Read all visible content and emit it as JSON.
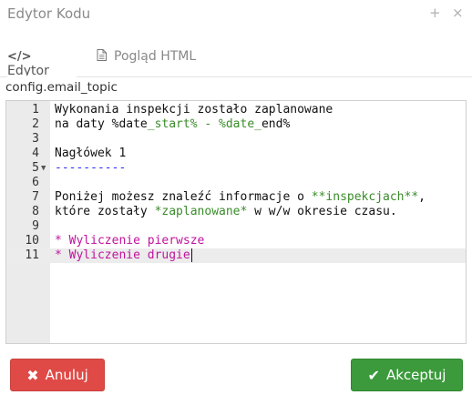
{
  "window": {
    "title": "Edytor Kodu",
    "plus_glyph": "+",
    "close_glyph": "×"
  },
  "tabs": [
    {
      "label": "Edytor",
      "icon": "code-icon",
      "active": true
    },
    {
      "label": "Pogląd HTML",
      "icon": "file-icon",
      "active": false
    }
  ],
  "config_label": "config.email_topic",
  "editor": {
    "line_numbers": [
      "1",
      "2",
      "3",
      "4",
      "5",
      "6",
      "7",
      "8",
      "9",
      "10",
      "11"
    ],
    "fold_marker_line": 5,
    "active_line": 11,
    "lines": [
      {
        "parts": [
          {
            "t": "Wykonania inspekcji zostało zaplanowane",
            "c": "plain"
          }
        ]
      },
      {
        "parts": [
          {
            "t": "na daty %date",
            "c": "plain"
          },
          {
            "t": "_start% - %date_",
            "c": "hl"
          },
          {
            "t": "end%",
            "c": "plain"
          }
        ]
      },
      {
        "parts": []
      },
      {
        "parts": [
          {
            "t": "Nagłówek 1",
            "c": "plain"
          }
        ]
      },
      {
        "parts": [
          {
            "t": "----------",
            "c": "md-rule"
          }
        ]
      },
      {
        "parts": []
      },
      {
        "parts": [
          {
            "t": "Poniżej możesz znaleźć informacje o ",
            "c": "plain"
          },
          {
            "t": "**inspekcjach**",
            "c": "hl"
          },
          {
            "t": ",",
            "c": "plain"
          }
        ]
      },
      {
        "parts": [
          {
            "t": "które zostały ",
            "c": "plain"
          },
          {
            "t": "*zaplanowane*",
            "c": "hl"
          },
          {
            "t": " w w/w okresie czasu.",
            "c": "plain"
          }
        ]
      },
      {
        "parts": []
      },
      {
        "parts": [
          {
            "t": "* Wyliczenie pierwsze",
            "c": "italic"
          }
        ]
      },
      {
        "parts": [
          {
            "t": "* Wyliczenie drugie",
            "c": "italic"
          }
        ]
      }
    ]
  },
  "buttons": {
    "cancel": {
      "label": "Anuluj",
      "icon": "x-icon",
      "glyph": "✖",
      "color": "#df4a47"
    },
    "accept": {
      "label": "Akceptuj",
      "icon": "check-icon",
      "glyph": "✔",
      "color": "#3c9a3c"
    }
  }
}
